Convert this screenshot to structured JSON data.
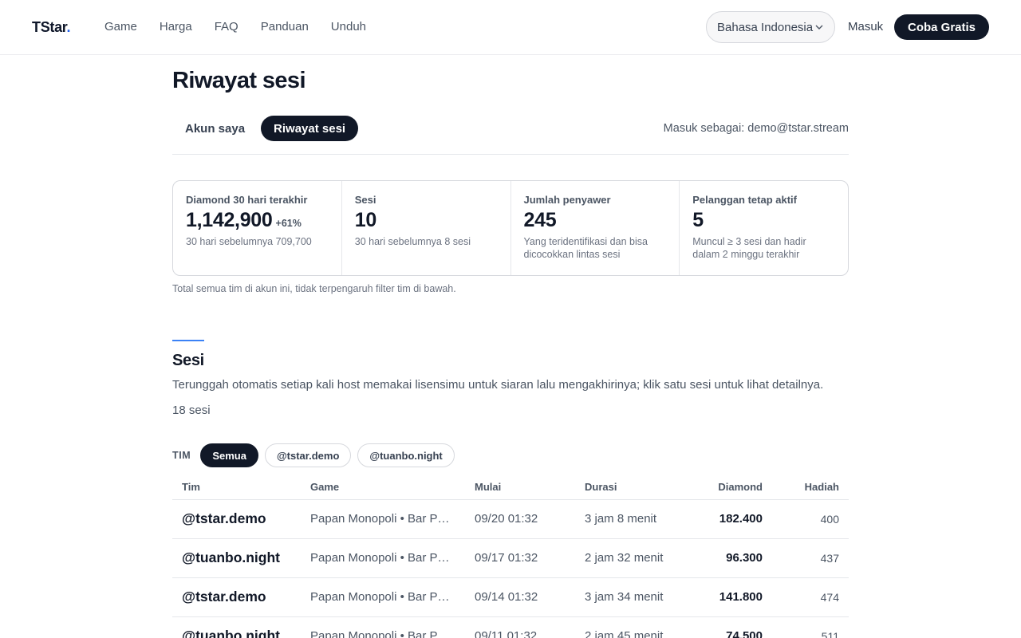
{
  "nav": {
    "logo": "TStar",
    "logo_dot": ".",
    "links": [
      "Game",
      "Harga",
      "FAQ",
      "Panduan",
      "Unduh"
    ],
    "language": "Bahasa Indonesia",
    "login": "Masuk",
    "cta": "Coba Gratis"
  },
  "page": {
    "title": "Riwayat sesi",
    "tabs": [
      {
        "label": "Akun saya",
        "active": false
      },
      {
        "label": "Riwayat sesi",
        "active": true
      }
    ],
    "signed_in": "Masuk sebagai: demo@tstar.stream"
  },
  "stats": [
    {
      "label": "Diamond 30 hari terakhir",
      "value": "1,142,900",
      "delta": "+61%",
      "sub": "30 hari sebelumnya 709,700"
    },
    {
      "label": "Sesi",
      "value": "10",
      "delta": "",
      "sub": "30 hari sebelumnya 8 sesi"
    },
    {
      "label": "Jumlah penyawer",
      "value": "245",
      "delta": "",
      "sub": "Yang teridentifikasi dan bisa dicocokkan lintas sesi"
    },
    {
      "label": "Pelanggan tetap aktif",
      "value": "5",
      "delta": "",
      "sub": "Muncul ≥ 3 sesi dan hadir dalam 2 minggu terakhir"
    }
  ],
  "stats_note": "Total semua tim di akun ini, tidak terpengaruh filter tim di bawah.",
  "sessions": {
    "title": "Sesi",
    "description": "Terunggah otomatis setiap kali host memakai lisensimu untuk siaran lalu mengakhirinya; klik satu sesi untuk lihat detailnya.",
    "count": "18 sesi",
    "filter_label": "TIM",
    "filters": [
      {
        "label": "Semua",
        "active": true
      },
      {
        "label": "@tstar.demo",
        "active": false
      },
      {
        "label": "@tuanbo.night",
        "active": false
      }
    ],
    "columns": [
      "Tim",
      "Game",
      "Mulai",
      "Durasi",
      "Diamond",
      "Hadiah"
    ],
    "rows": [
      {
        "team": "@tstar.demo",
        "game": "Papan Monopoli  •  Bar Permainan",
        "start": "09/20 01:32",
        "duration": "3 jam 8 menit",
        "diamond": "182.400",
        "gift": "400"
      },
      {
        "team": "@tuanbo.night",
        "game": "Papan Monopoli  •  Bar Permainan",
        "start": "09/17 01:32",
        "duration": "2 jam 32 menit",
        "diamond": "96.300",
        "gift": "437"
      },
      {
        "team": "@tstar.demo",
        "game": "Papan Monopoli  •  Bar Permainan",
        "start": "09/14 01:32",
        "duration": "3 jam 34 menit",
        "diamond": "141.800",
        "gift": "474"
      },
      {
        "team": "@tuanbo.night",
        "game": "Papan Monopoli  •  Bar Permainan",
        "start": "09/11 01:32",
        "duration": "2 jam 45 menit",
        "diamond": "74.500",
        "gift": "511"
      }
    ]
  }
}
